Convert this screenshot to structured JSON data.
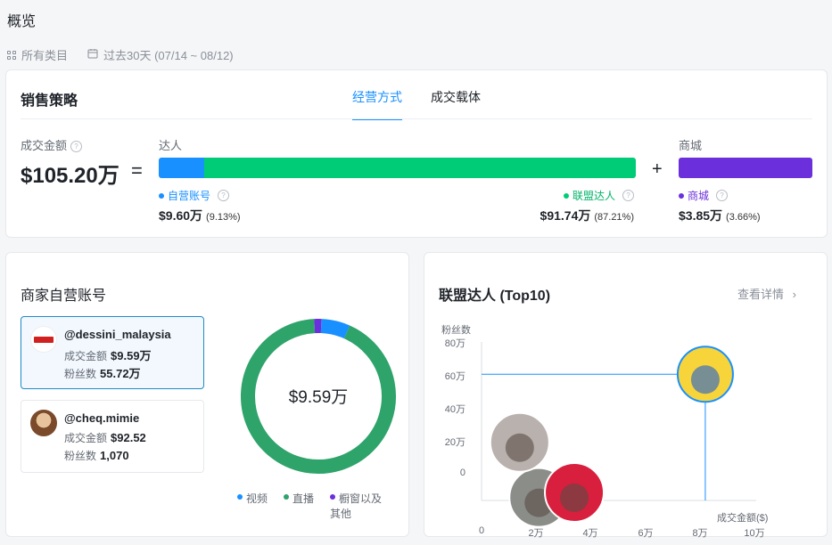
{
  "page": {
    "title": "概览"
  },
  "filters": {
    "category": "所有类目",
    "date_range": "过去30天 (07/14 ~ 08/12)"
  },
  "strategy": {
    "title": "销售策略",
    "tabs": [
      "经营方式",
      "成交载体"
    ],
    "active_tab": "经营方式",
    "gmv_label": "成交金额",
    "gmv_value": "$105.20万",
    "equals": "=",
    "plus": "+",
    "creator_group": "达人",
    "mall_group": "商城",
    "bar_fractions": {
      "self": 0.0913,
      "affiliate": 0.8721,
      "mall": 0.0366
    },
    "self": {
      "label": "自营账号",
      "value": "$9.60万",
      "pct": "(9.13%)",
      "color": "#1890ff"
    },
    "affiliate": {
      "label": "联盟达人",
      "value": "$91.74万",
      "pct": "(87.21%)",
      "color": "#00cc77"
    },
    "mall": {
      "label": "商城",
      "value": "$3.85万",
      "pct": "(3.66%)",
      "color": "#6b2fdc"
    }
  },
  "self_accounts": {
    "title": "商家自营账号",
    "accounts": [
      {
        "name": "@dessini_malaysia",
        "gmv_label": "成交金额",
        "gmv": "$9.59万",
        "fans_label": "粉丝数",
        "fans": "55.72万"
      },
      {
        "name": "@cheq.mimie",
        "gmv_label": "成交金额",
        "gmv": "$92.52",
        "fans_label": "粉丝数",
        "fans": "1,070"
      }
    ],
    "donut_center": "$9.59万",
    "donut_shares": [
      {
        "name": "视频",
        "fraction": 0.06,
        "color": "#1890ff"
      },
      {
        "name": "直播",
        "fraction": 0.925,
        "color": "#2ea36a"
      },
      {
        "name": "橱窗以及其他",
        "fraction": 0.015,
        "color": "#6b2fdc"
      }
    ],
    "legend": [
      "视频",
      "直播",
      "橱窗以及",
      "其他"
    ]
  },
  "affiliates": {
    "title": "联盟达人 (Top10)",
    "details_link": "查看详情",
    "y_axis_title": "粉丝数",
    "x_axis_title": "成交金额($)",
    "y_ticks": [
      "80万",
      "60万",
      "40万",
      "20万",
      "0"
    ],
    "x_ticks": [
      "0",
      "2万",
      "4万",
      "6万",
      "8万",
      "10万"
    ],
    "points": [
      {
        "x": 8.2,
        "y": 63,
        "highlight": true
      },
      {
        "x": 1.4,
        "y": 29
      },
      {
        "x": 3.4,
        "y": 4
      },
      {
        "x": 2.1,
        "y": 1.5
      }
    ]
  }
}
